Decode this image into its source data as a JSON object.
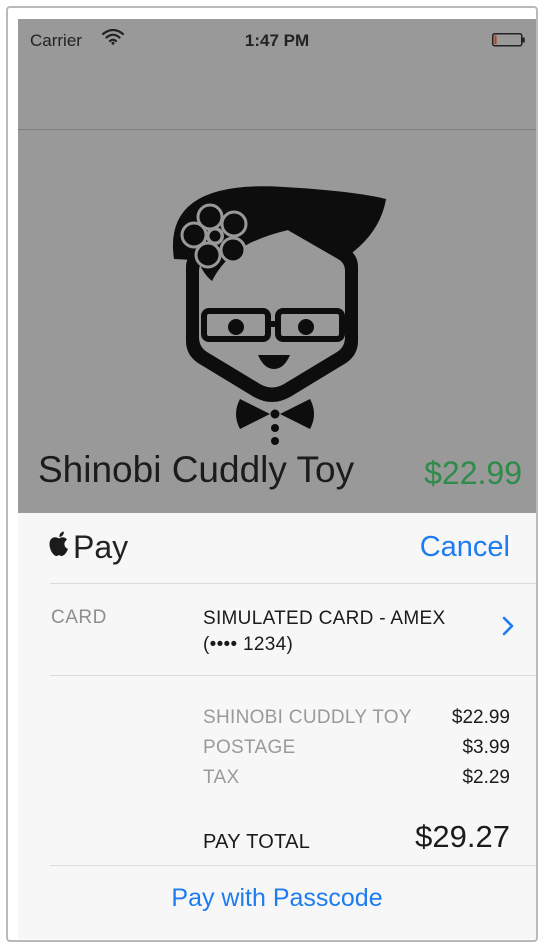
{
  "status_bar": {
    "carrier": "Carrier",
    "time": "1:47 PM"
  },
  "product": {
    "name": "Shinobi Cuddly Toy",
    "price": "$22.99",
    "price_color": "#2e8b4a"
  },
  "payment_sheet": {
    "pay_label": "Pay",
    "cancel_label": "Cancel",
    "card": {
      "label": "CARD",
      "line1": "SIMULATED CARD - AMEX",
      "line2": "(•••• 1234)"
    },
    "summary_items": [
      {
        "label": "SHINOBI CUDDLY TOY",
        "amount": "$22.99"
      },
      {
        "label": "POSTAGE",
        "amount": "$3.99"
      },
      {
        "label": "TAX",
        "amount": "$2.29"
      }
    ],
    "total": {
      "label": "PAY TOTAL",
      "amount": "$29.27"
    },
    "pay_button_label": "Pay with Passcode"
  },
  "colors": {
    "accent": "#1e7cf2",
    "dim_overlay": "#999999",
    "sheet_bg": "#f7f7f7"
  },
  "icons": [
    "wifi-icon",
    "battery-icon",
    "apple-logo-icon",
    "chevron-right-icon",
    "shinobi-mascot"
  ]
}
